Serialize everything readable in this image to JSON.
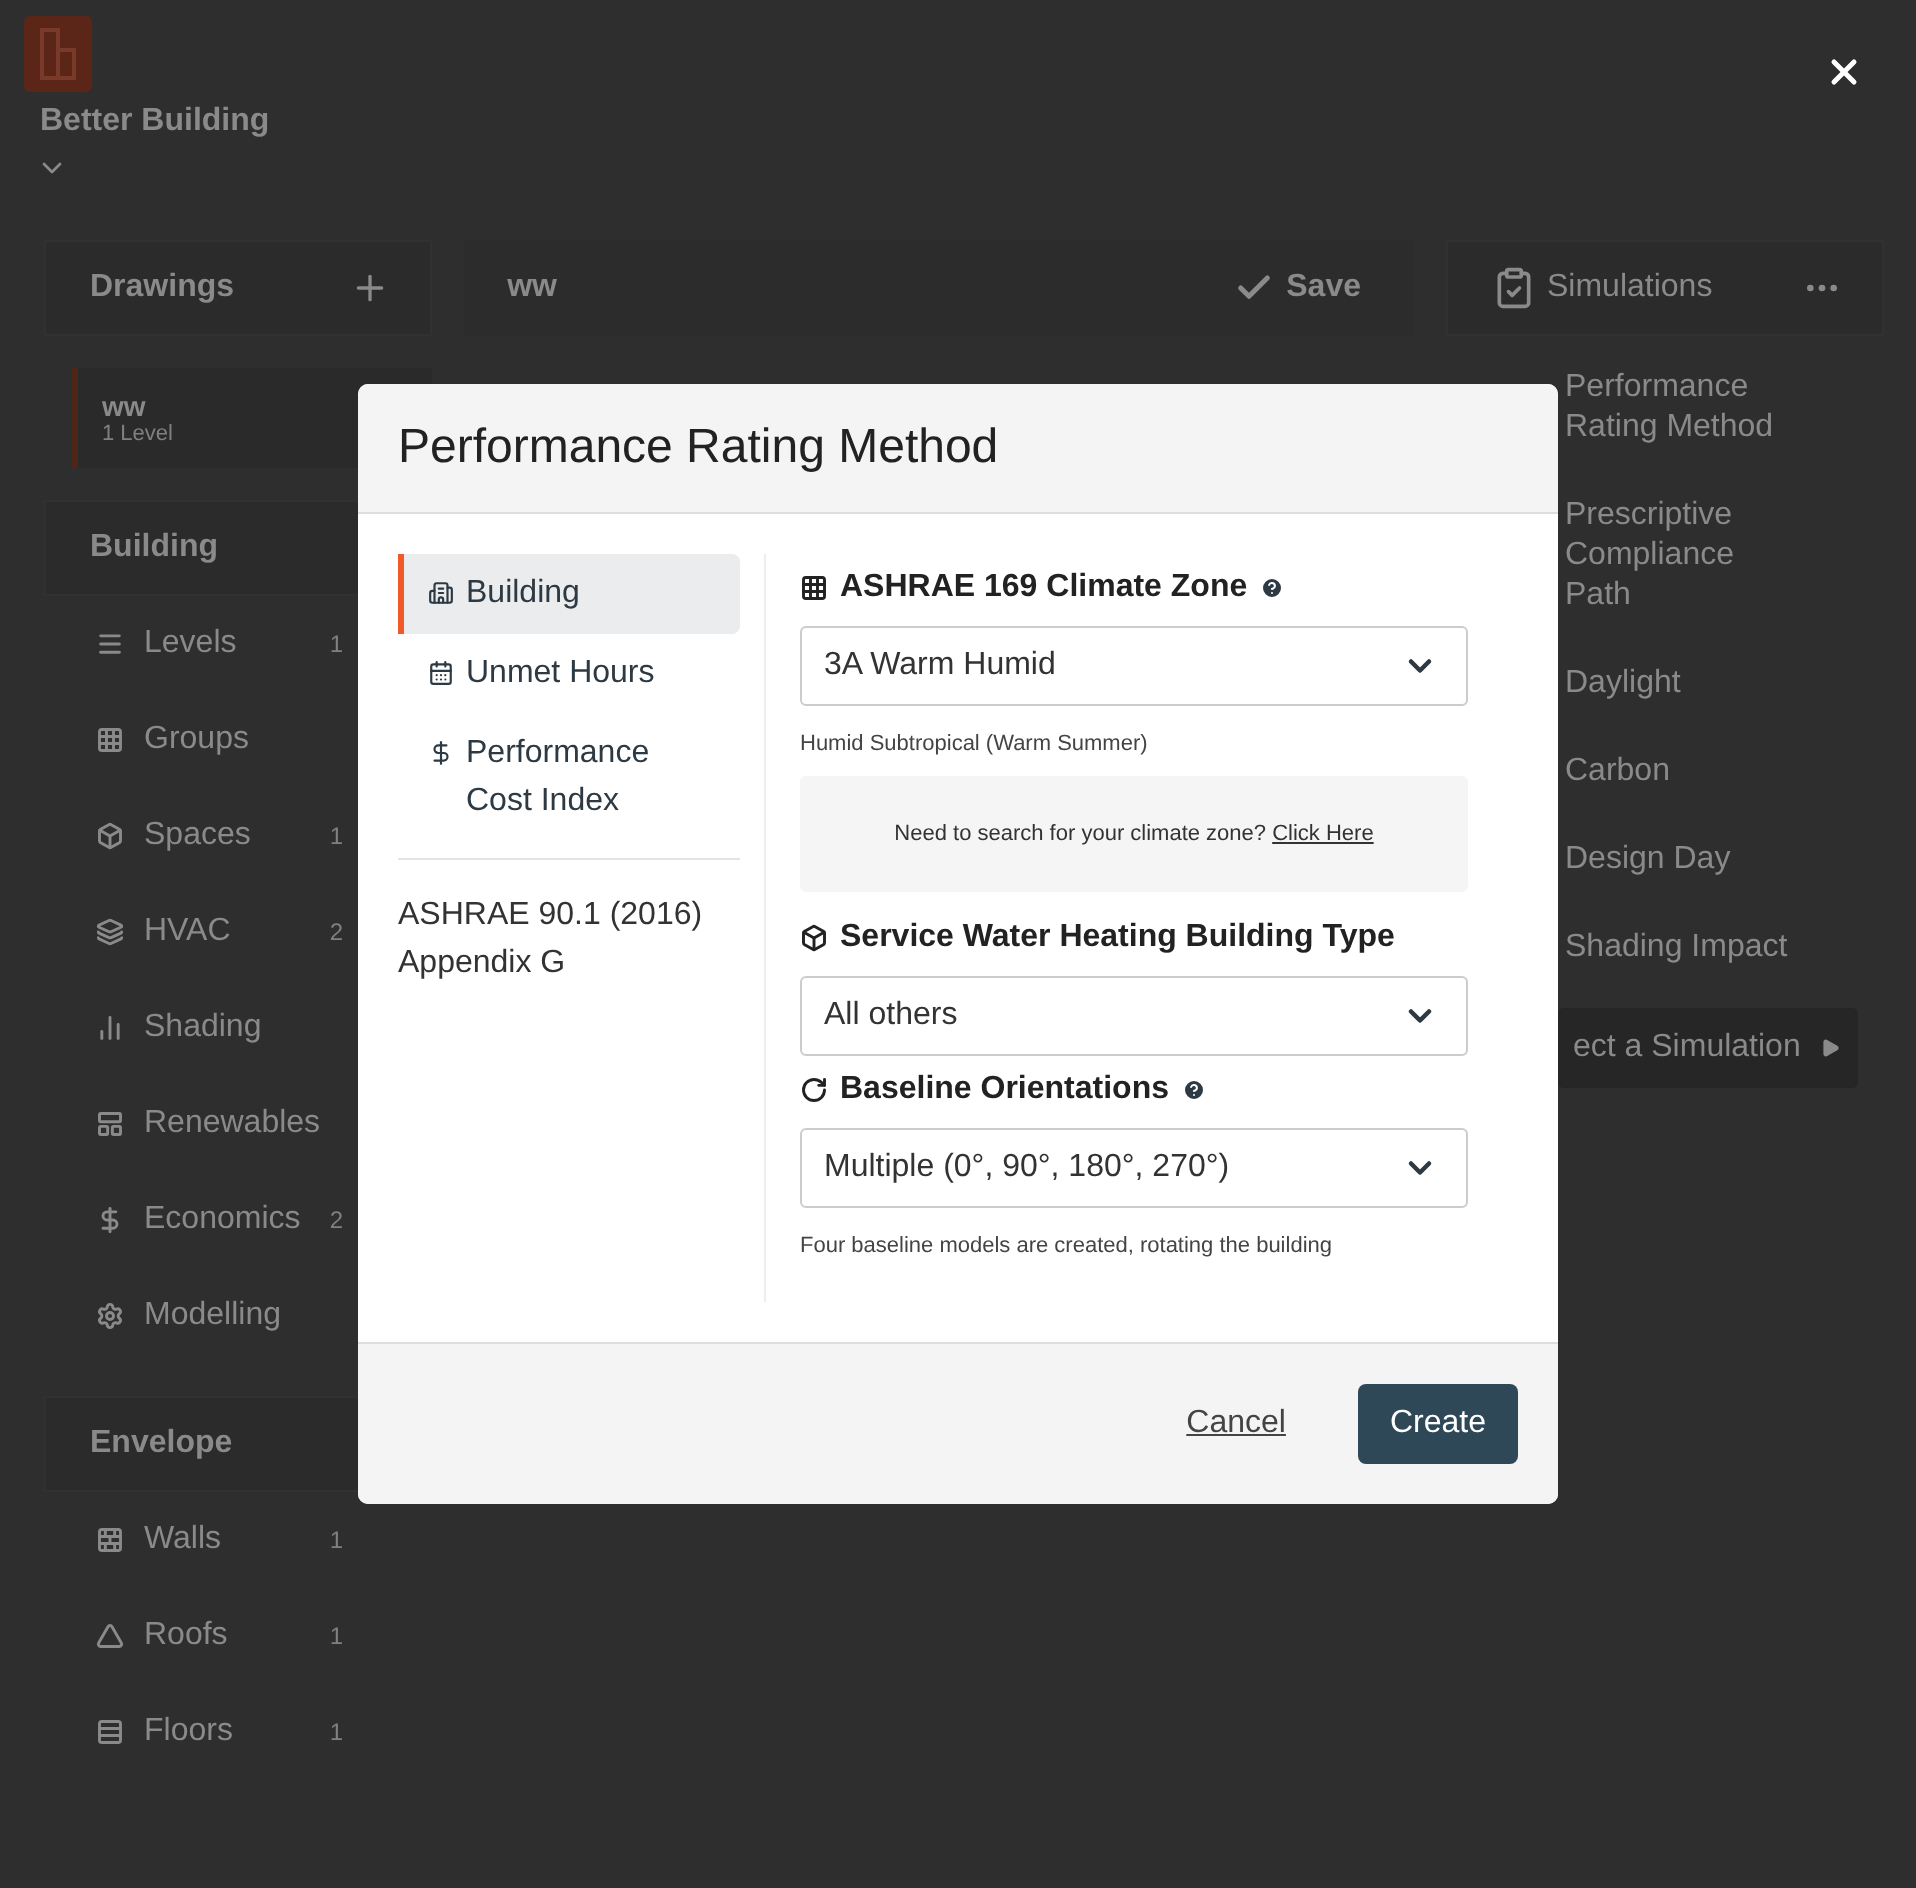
{
  "header": {
    "brand": "Better Building"
  },
  "drawings": {
    "title": "Drawings",
    "items": [
      {
        "name": "ww",
        "detail": "1 Level",
        "selected": true
      }
    ]
  },
  "building": {
    "title": "Building",
    "items": [
      {
        "label": "Levels",
        "count": "1"
      },
      {
        "label": "Groups"
      },
      {
        "label": "Spaces",
        "count": "1"
      },
      {
        "label": "HVAC",
        "count": "2"
      },
      {
        "label": "Shading"
      },
      {
        "label": "Renewables"
      },
      {
        "label": "Economics",
        "count": "2"
      },
      {
        "label": "Modelling"
      }
    ]
  },
  "envelope": {
    "title": "Envelope",
    "items": [
      {
        "label": "Walls",
        "count": "1"
      },
      {
        "label": "Roofs",
        "count": "1"
      },
      {
        "label": "Floors",
        "count": "1"
      }
    ]
  },
  "canvas": {
    "drawing_name": "ww",
    "save_label": "Save"
  },
  "simulations": {
    "title": "Simulations",
    "items": [
      "Performance Rating Method",
      "Prescriptive Compliance Path",
      "Daylight",
      "Carbon",
      "Design Day",
      "Shading Impact"
    ],
    "run_button": "ect a Simulation"
  },
  "modal": {
    "title": "Performance Rating Method",
    "nav": [
      {
        "label": "Building",
        "selected": true
      },
      {
        "label": "Unmet Hours",
        "selected": false
      },
      {
        "label": "Performance Cost Index",
        "selected": false
      }
    ],
    "standard": "ASHRAE 90.1 (2016) Appendix G",
    "fields": [
      {
        "label": "ASHRAE 169 Climate Zone",
        "help": true,
        "value": "3A Warm Humid",
        "note": "Humid Subtropical (Warm Summer)"
      },
      {
        "label": "Service Water Heating Building Type",
        "help": false,
        "value": "All others"
      },
      {
        "label": "Baseline Orientations",
        "help": true,
        "value": "Multiple (0°, 90°, 180°, 270°)",
        "note": "Four baseline models are created, rotating the building"
      }
    ],
    "info": {
      "text": "Need to search for your climate zone?",
      "link": "Click Here"
    },
    "cancel": "Cancel",
    "create": "Create"
  }
}
